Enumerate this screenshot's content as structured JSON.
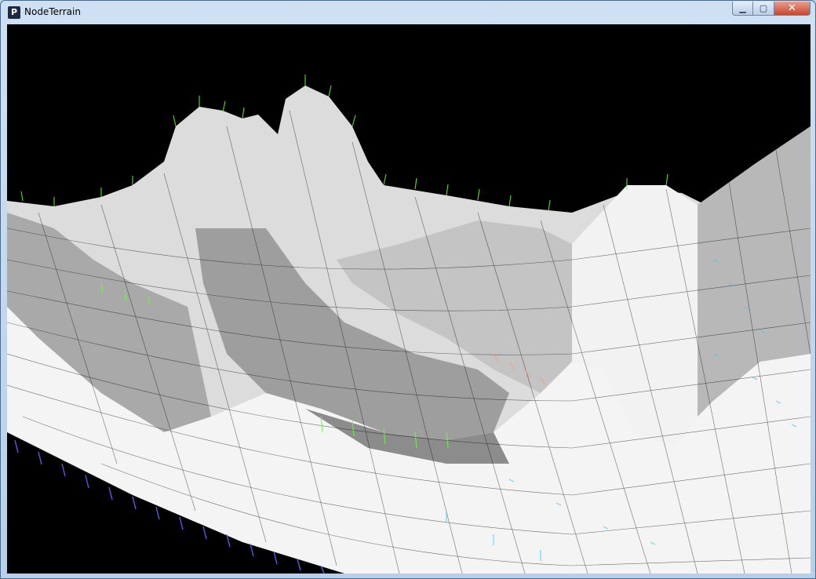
{
  "window": {
    "title": "NodeTerrain",
    "app_icon_letter": "P",
    "controls": {
      "minimize": "▁",
      "maximize": "▢",
      "close": "✕"
    }
  },
  "viewport": {
    "background": "#000000",
    "terrain_fill": "#e6e6e6",
    "mesh_line_color": "#000000",
    "normal_colors": [
      "#66ff33",
      "#33ffcc",
      "#3366ff",
      "#cc66ff",
      "#ff9966"
    ]
  }
}
